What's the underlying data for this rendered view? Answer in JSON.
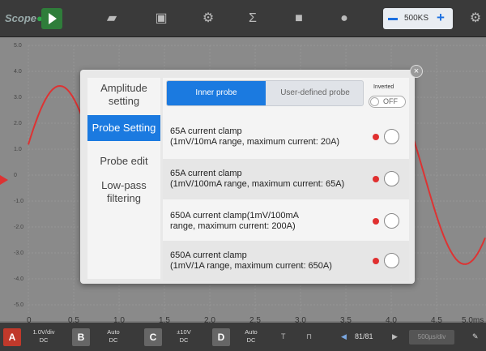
{
  "app": {
    "logo_text": "Scope",
    "logo_mark": "●"
  },
  "toolbar": {
    "icons": [
      "play-icon",
      "car-icon",
      "save-icon",
      "gear-icon",
      "sigma-icon",
      "folder-icon",
      "help-icon",
      "settings-icon"
    ],
    "rate_label": "500KS"
  },
  "scope": {
    "y_ticks": [
      "5.0",
      "4.0",
      "3.0",
      "2.0",
      "1.0",
      "0",
      "-1.0",
      "-2.0",
      "-3.0",
      "-4.0",
      "-5.0"
    ],
    "x_ticks": [
      "0",
      "0.5",
      "1.0",
      "1.5",
      "2.0",
      "2.5",
      "3.0",
      "3.5",
      "4.0",
      "4.5",
      "5.0ms"
    ],
    "colors": {
      "waveform": "#d33",
      "grid": "#9a9a9a"
    }
  },
  "bottom": {
    "channel_a": "A",
    "channel_a_range": "1.0V/div",
    "channel_a_coupling": "DC",
    "channel_b": "B",
    "channel_b_range": "Auto",
    "channel_b_coupling": "DC",
    "channel_c": "C",
    "channel_c_range": "±10V",
    "channel_c_coupling": "DC",
    "channel_d": "D",
    "channel_d_range": "Auto",
    "channel_d_coupling": "DC",
    "trigger": "T",
    "frame_count": "81/81",
    "field_placeholder": "500µs/div"
  },
  "modal": {
    "close_glyph": "×",
    "side_items": [
      {
        "label": "Amplitude setting"
      },
      {
        "label": "Probe Setting"
      },
      {
        "label": "Probe edit"
      },
      {
        "label": "Low-pass filtering"
      }
    ],
    "tabs": {
      "inner": "Inner probe",
      "user": "User-defined probe"
    },
    "inverted_label": "Inverted",
    "toggle_value": "OFF",
    "probes": [
      {
        "line1": "65A current clamp",
        "line2": " (1mV/10mA range, maximum current: 20A)"
      },
      {
        "line1": "65A current clamp",
        "line2": " (1mV/100mA range, maximum current: 65A)"
      },
      {
        "line1": "650A current clamp(1mV/100mA",
        "line2": " range, maximum current: 200A)"
      },
      {
        "line1": "650A current clamp",
        "line2": " (1mV/1A range, maximum current: 650A)"
      }
    ]
  }
}
